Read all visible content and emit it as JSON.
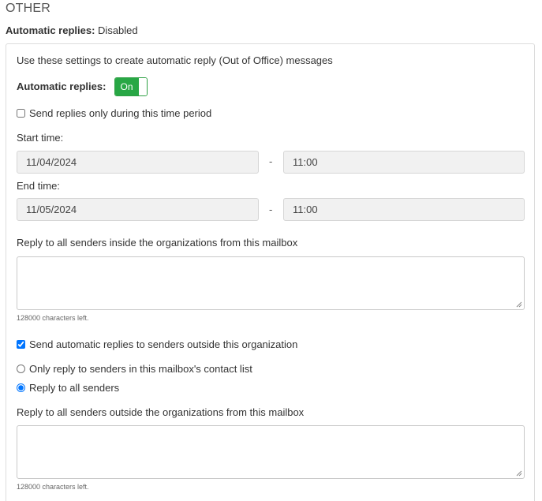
{
  "section": {
    "title": "OTHER"
  },
  "status": {
    "label": "Automatic replies:",
    "value": "Disabled"
  },
  "panel": {
    "intro": "Use these settings to create automatic reply (Out of Office) messages",
    "auto_replies_label": "Automatic replies:",
    "toggle_label": "On",
    "toggle_state": "on",
    "accent_color": "#28a745",
    "time_period_label": "Send replies only during this time period",
    "time_period_checked": false,
    "start_time_label": "Start time:",
    "start_date": "11/04/2024",
    "start_time": "11:00",
    "end_time_label": "End time:",
    "end_date": "11/05/2024",
    "end_time": "11:00",
    "separator": "-",
    "inside_label": "Reply to all senders inside the organizations from this mailbox",
    "inside_message": "",
    "inside_chars_left": "128000 characters left.",
    "outside_checkbox_label": "Send automatic replies to senders outside this organization",
    "outside_checked": true,
    "radio_options": [
      {
        "label": "Only reply to senders in this mailbox's contact list",
        "selected": false
      },
      {
        "label": "Reply to all senders",
        "selected": true
      }
    ],
    "outside_label": "Reply to all senders outside the organizations from this mailbox",
    "outside_message": "",
    "outside_chars_left": "128000 characters left."
  }
}
